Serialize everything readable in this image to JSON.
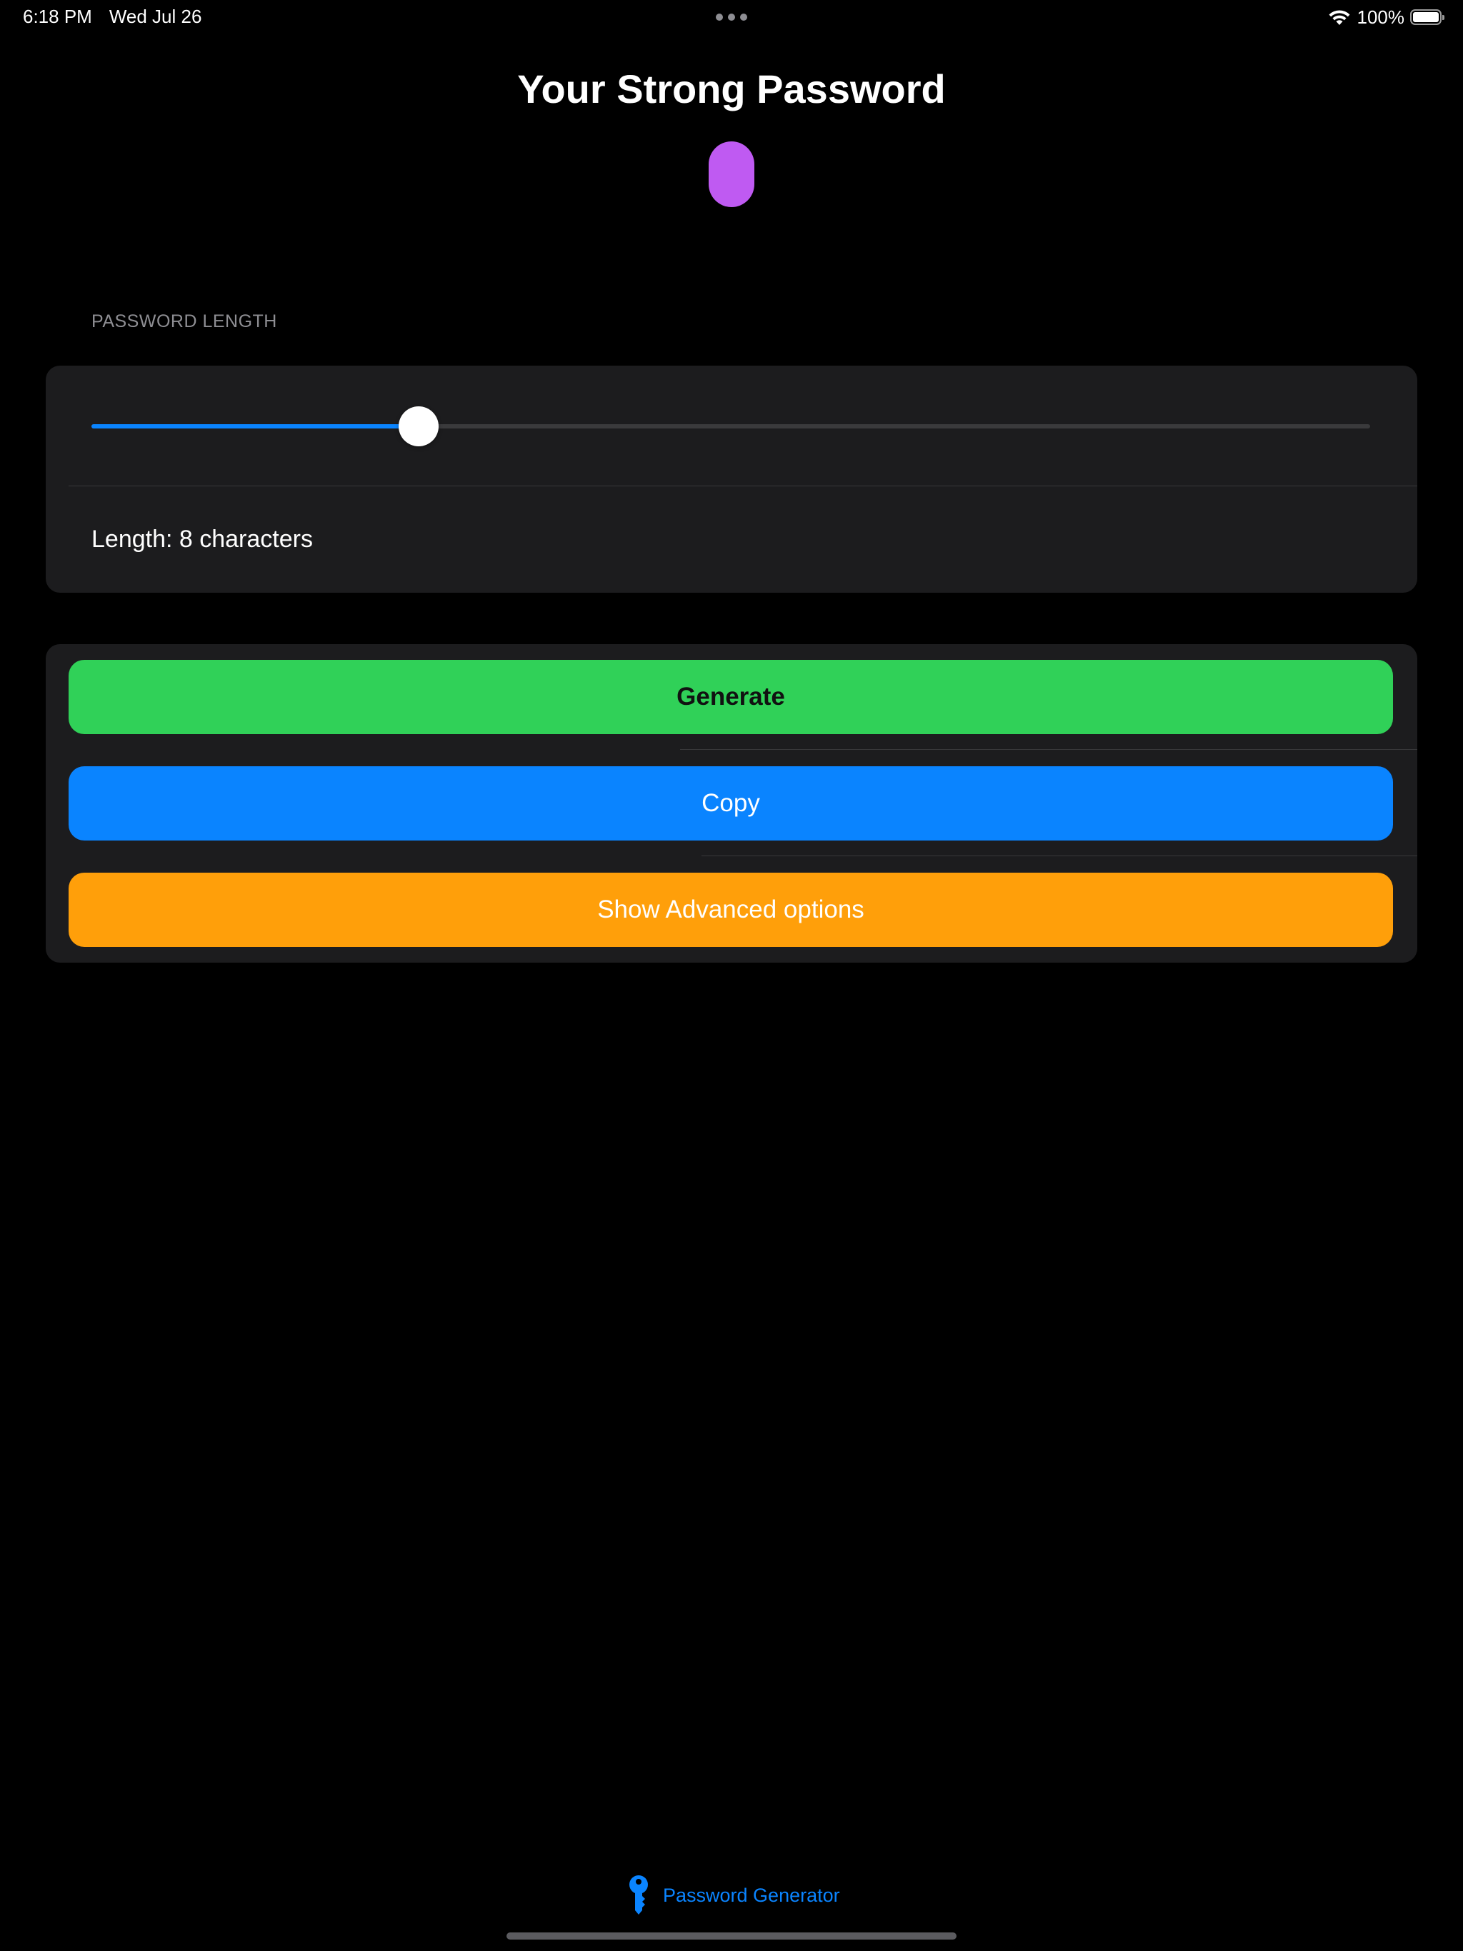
{
  "status_bar": {
    "time": "6:18 PM",
    "date": "Wed Jul 26",
    "battery_percent": "100%",
    "battery_level": 1.0,
    "icons": [
      "multitasking-dots-icon",
      "wifi-icon",
      "battery-icon"
    ]
  },
  "main": {
    "title": "Your Strong Password",
    "password_value": "",
    "password_pill_color": "#bf5af2"
  },
  "length_section": {
    "header": "PASSWORD LENGTH",
    "slider_value_fraction": 0.256,
    "length_text": "Length: 8 characters",
    "slider_accent": "#0a84ff"
  },
  "actions": {
    "generate_label": "Generate",
    "copy_label": "Copy",
    "advanced_label": "Show Advanced options",
    "colors": {
      "generate": "#30d158",
      "copy": "#0a84ff",
      "advanced": "#ff9f0a"
    }
  },
  "tab_bar": {
    "items": [
      {
        "label": "Password Generator",
        "icon": "key-icon",
        "selected": true
      }
    ]
  }
}
